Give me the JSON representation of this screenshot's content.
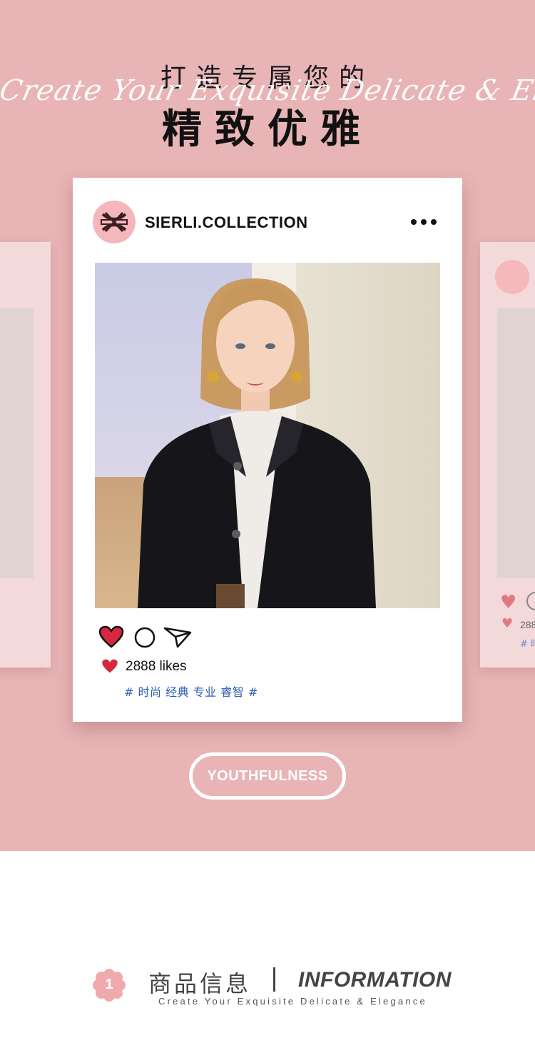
{
  "header": {
    "line1": "打造专属您的",
    "script": "Create Your Exquisite Delicate & Elegance",
    "line2": "精致优雅"
  },
  "post": {
    "username": "SIERLI.COLLECTION",
    "likes": "2888 likes",
    "hashtags": "# 时尚 经典 专业 睿智 #",
    "like_color": "#d8283f"
  },
  "side_card": {
    "likes": "288",
    "tag": "# 时"
  },
  "pill_label": "YOUTHFULNESS",
  "footer": {
    "badge": "1",
    "title_cn": "商品信息",
    "title_en": "INFORMATION",
    "subtitle": "Create Your Exquisite Delicate & Elegance"
  },
  "colors": {
    "background_pink": "#e8b4b6",
    "accent_pink": "#f5b6bc",
    "hashtag_blue": "#2d5fb5"
  },
  "icons": [
    "brand-logo-icon",
    "more-icon",
    "heart-icon",
    "comment-icon",
    "send-icon",
    "flower-badge-icon"
  ]
}
